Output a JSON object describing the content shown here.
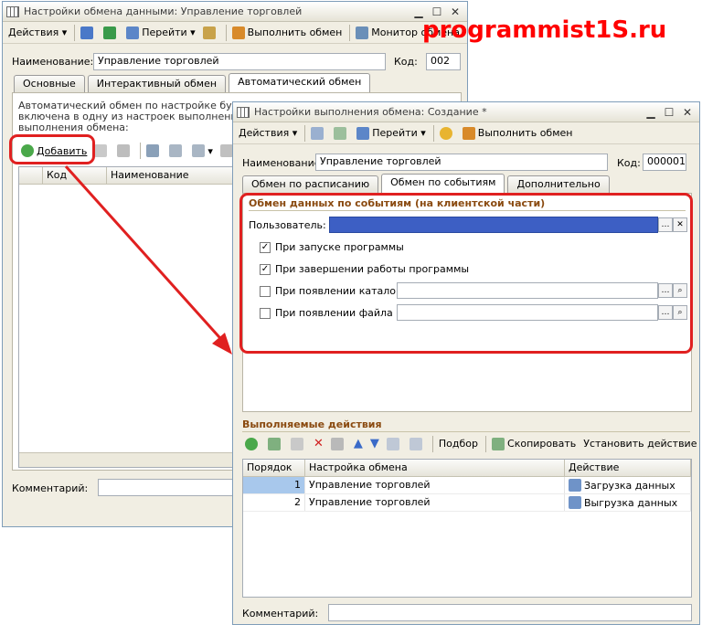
{
  "watermark": "programmist1S.ru",
  "back_window": {
    "title": "Настройки обмена данными: Управление торговлей",
    "toolbar": {
      "actions": "Действия",
      "goto": "Перейти",
      "execute": "Выполнить обмен",
      "monitor": "Монитор обмена"
    },
    "name_label": "Наименование:",
    "name_value": "Управление торговлей",
    "code_label": "Код:",
    "code_value": "002",
    "tabs": [
      "Основные",
      "Интерактивный обмен",
      "Автоматический обмен"
    ],
    "info_lines": [
      "Автоматический обмен по настройке будет вы",
      "включена в одну из настроек выполнения обм",
      "выполнения обмена:"
    ],
    "add_button": "Добавить",
    "grid_columns": [
      "Код",
      "Наименование"
    ],
    "comment_label": "Комментарий:"
  },
  "front_window": {
    "title": "Настройки выполнения обмена: Создание *",
    "toolbar": {
      "actions": "Действия",
      "goto": "Перейти",
      "execute": "Выполнить обмен"
    },
    "name_label": "Наименование:",
    "name_value": "Управление торговлей",
    "code_label": "Код:",
    "code_value": "000001",
    "tabs": [
      "Обмен по расписанию",
      "Обмен по событиям",
      "Дополнительно"
    ],
    "section_title": "Обмен данных по событиям (на клиентской части)",
    "user_label": "Пользователь:",
    "checkboxes": [
      {
        "label": "При запуске программы",
        "checked": true
      },
      {
        "label": "При завершении работы программы",
        "checked": true
      },
      {
        "label": "При появлении каталога",
        "checked": false
      },
      {
        "label": "При появлении файла",
        "checked": false
      }
    ],
    "actions_title": "Выполняемые действия",
    "actions_toolbar": {
      "select": "Подбор",
      "copy": "Скопировать",
      "set_action": "Установить действие"
    },
    "grid_columns": [
      "Порядок",
      "Настройка обмена",
      "Действие"
    ],
    "rows": [
      {
        "order": "1",
        "setting": "Управление торговлей",
        "action": "Загрузка данных"
      },
      {
        "order": "2",
        "setting": "Управление торговлей",
        "action": "Выгрузка данных"
      }
    ],
    "comment_label": "Комментарий:"
  },
  "colors": {
    "highlight_red": "#e02020",
    "user_field_blue": "#3d5fc4",
    "selected_cell": "#a8c8ec",
    "section_title": "#8a4a10"
  }
}
